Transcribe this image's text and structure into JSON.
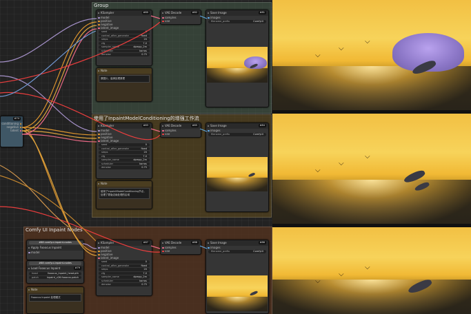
{
  "groups": [
    {
      "title": "Group"
    },
    {
      "title": "使用了InpaintModelConditioning的增强工作流"
    },
    {
      "title": "Comfy UI Inpaint Nodes"
    }
  ],
  "nodes": {
    "ksampler": "KSampler",
    "vae_decode": "VAE Decode",
    "save_image": "Save Image",
    "note": "Note",
    "apply_fooocus": "Apply Fooocus Inpaint",
    "load_fooocus": "Load Fooocus Inpaint",
    "load_model": "Load Model"
  },
  "ids": {
    "g1_ks": "#80",
    "g1_vae": "#82",
    "g1_save": "#81",
    "g2_ks": "#83",
    "g2_vae": "#85",
    "g2_save": "#84",
    "g3_ks": "#87",
    "g3_vae": "#88",
    "g3_save": "#86",
    "left": "#74",
    "apply": "#78",
    "load": "#79"
  },
  "ports": {
    "model": "model",
    "positive": "positive",
    "negative": "negative",
    "latent_image": "latent_image",
    "latent": "LATENT",
    "samples": "samples",
    "vae": "vae",
    "image": "IMAGE",
    "images": "images",
    "patch": "patch",
    "model_out": "MODEL",
    "conditioning": "conditioning",
    "latent_out": "latent"
  },
  "widgets": {
    "seed": "seed",
    "control": "control_after_generate",
    "steps": "steps",
    "cfg": "cfg",
    "sampler": "sampler_name",
    "scheduler": "scheduler",
    "denoise": "denoise",
    "seed_v": "0",
    "control_v": "fixed",
    "steps_v": "20",
    "cfg_v": "7.0",
    "sampler_v": "dpmpp_2m",
    "scheduler_v": "karras",
    "denoise_v": "0.75",
    "filename_prefix": "filename_prefix",
    "filename_v": "ComfyUI",
    "head": "head",
    "head_v": "fooocus_inpaint_head.pth",
    "patch": "patch",
    "patch_v": "inpaint_v26.fooocus.patch"
  },
  "github_label": "#88 comfyui-inpaint-nodes",
  "notes": {
    "g1": "原图片，高清处理原理",
    "g2": "使用了InpaintModelConditioning节点，处理了蒙版边缘处理的区域",
    "g3": "Fooocus Inpaint 处理模式"
  },
  "colors": {
    "group1": "#465b48",
    "group2": "#5a4a21",
    "group3": "#5a3520"
  }
}
